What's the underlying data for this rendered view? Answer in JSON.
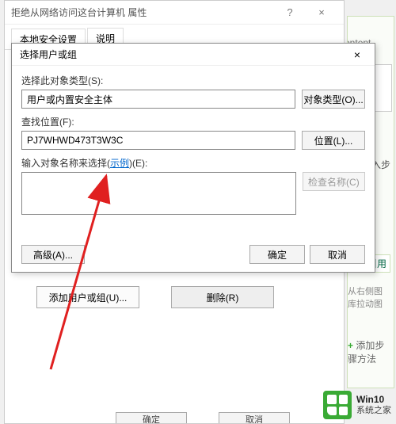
{
  "parent_window": {
    "title": "拒绝从网络访问这台计算机 属性",
    "help_btn": "?",
    "close_btn": "×",
    "tabs": {
      "tab1": "本地安全设置",
      "tab2": "说明"
    },
    "add_user_btn": "添加用户或组(U)...",
    "remove_btn": "删除(R)",
    "footer_ok": "确定",
    "footer_cancel": "取消"
  },
  "child_window": {
    "title": "选择用户或组",
    "close_btn": "×",
    "object_type_label": "选择此对象类型(S):",
    "object_type_value": "用户或内置安全主体",
    "object_type_btn": "对象类型(O)...",
    "location_label": "查找位置(F):",
    "location_value": "PJ7WHWD473T3W3C",
    "location_btn": "位置(L)...",
    "names_label_prefix": "输入对象名称来选择(",
    "names_label_link": "示例",
    "names_label_suffix": ")(E):",
    "check_names_btn": "检查名称(C)",
    "advanced_btn": "高级(A)...",
    "ok_btn": "确定",
    "cancel_btn": "取消"
  },
  "right_panel": {
    "content_tab": "dit/content",
    "step_label": "入步",
    "cite_label": "引用",
    "drag_label": "从右侧图库拉动图",
    "add_step_label": "添加步骤方法"
  },
  "watermark": {
    "line1": "Win10",
    "line2": "系统之家"
  }
}
